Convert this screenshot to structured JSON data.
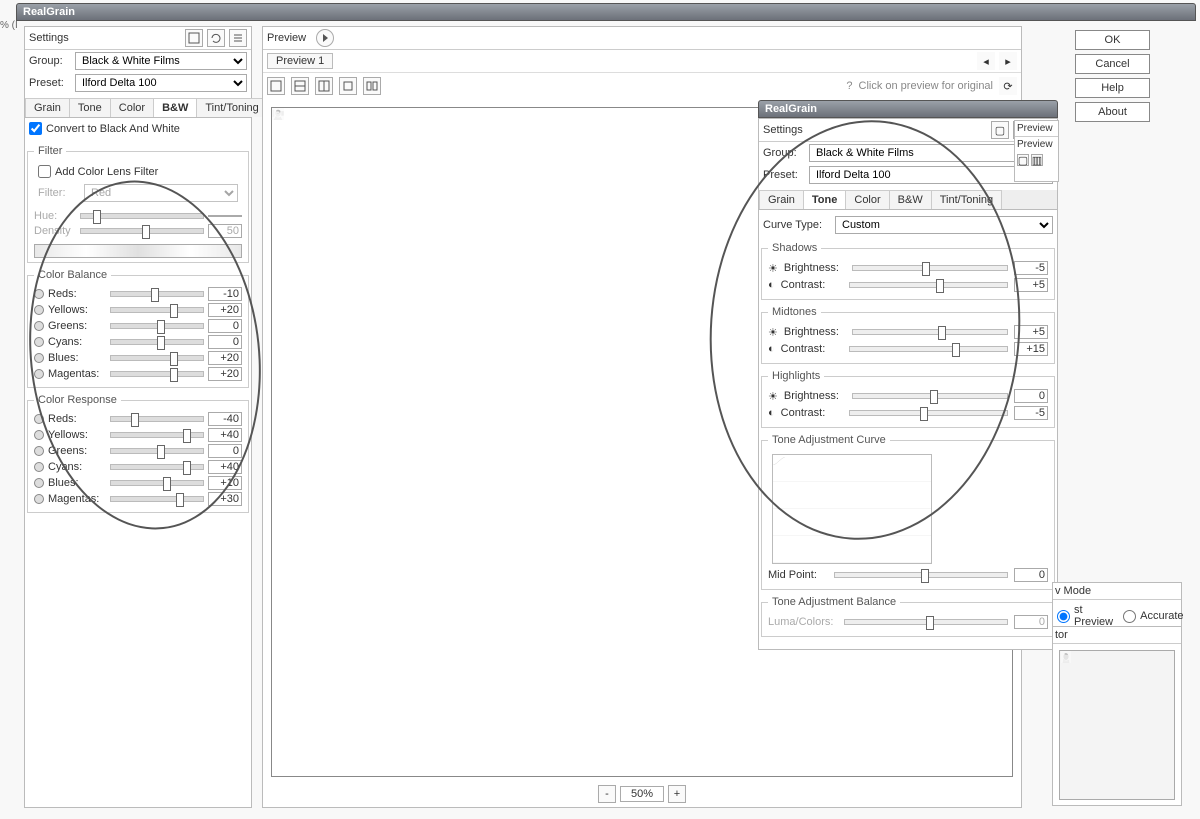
{
  "app_title": "RealGrain",
  "buttons": {
    "ok": "OK",
    "cancel": "Cancel",
    "help": "Help",
    "about": "About"
  },
  "left": {
    "settings_title": "Settings",
    "group_label": "Group:",
    "group_value": "Black & White Films",
    "preset_label": "Preset:",
    "preset_value": "Ilford Delta 100",
    "tabs": [
      "Grain",
      "Tone",
      "Color",
      "B&W",
      "Tint/Toning"
    ],
    "active_tab": 3,
    "convert_bw": "Convert to Black And White",
    "filter_title": "Filter",
    "add_lens": "Add Color Lens Filter",
    "filter_label": "Filter:",
    "filter_value": "Red",
    "hue_label": "Hue:",
    "density_label": "Density",
    "density_value": "50",
    "color_balance_title": "Color Balance",
    "color_response_title": "Color Response",
    "channels": [
      "Reds:",
      "Yellows:",
      "Greens:",
      "Cyans:",
      "Blues:",
      "Magentas:"
    ],
    "balance_values": [
      "-10",
      "+20",
      "0",
      "0",
      "+20",
      "+20"
    ],
    "response_values": [
      "-40",
      "+40",
      "0",
      "+40",
      "+10",
      "+30"
    ]
  },
  "preview": {
    "title": "Preview",
    "tab": "Preview 1",
    "hint": "Click on preview for original",
    "zoom": "50%"
  },
  "right": {
    "app_title": "RealGrain",
    "settings_title": "Settings",
    "preview_title": "Preview",
    "preview_tab": "Preview",
    "group_label": "Group:",
    "group_value": "Black & White Films",
    "preset_label": "Preset:",
    "preset_value": "Ilford Delta 100",
    "tabs": [
      "Grain",
      "Tone",
      "Color",
      "B&W",
      "Tint/Toning"
    ],
    "active_tab": 1,
    "curve_type_label": "Curve Type:",
    "curve_type_value": "Custom",
    "shadows_title": "Shadows",
    "midtones_title": "Midtones",
    "highlights_title": "Highlights",
    "brightness_label": "Brightness:",
    "contrast_label": "Contrast:",
    "shadows": {
      "brightness": "-5",
      "contrast": "+5"
    },
    "midtones": {
      "brightness": "+5",
      "contrast": "+15"
    },
    "highlights": {
      "brightness": "0",
      "contrast": "-5"
    },
    "curve_title": "Tone Adjustment Curve",
    "midpoint_label": "Mid Point:",
    "midpoint_value": "0",
    "balance_title": "Tone Adjustment Balance",
    "luma_label": "Luma/Colors:",
    "luma_value": "0"
  },
  "nav": {
    "mode_title": "v Mode",
    "fast": "st Preview",
    "accurate": "Accurate",
    "tor": "tor"
  }
}
